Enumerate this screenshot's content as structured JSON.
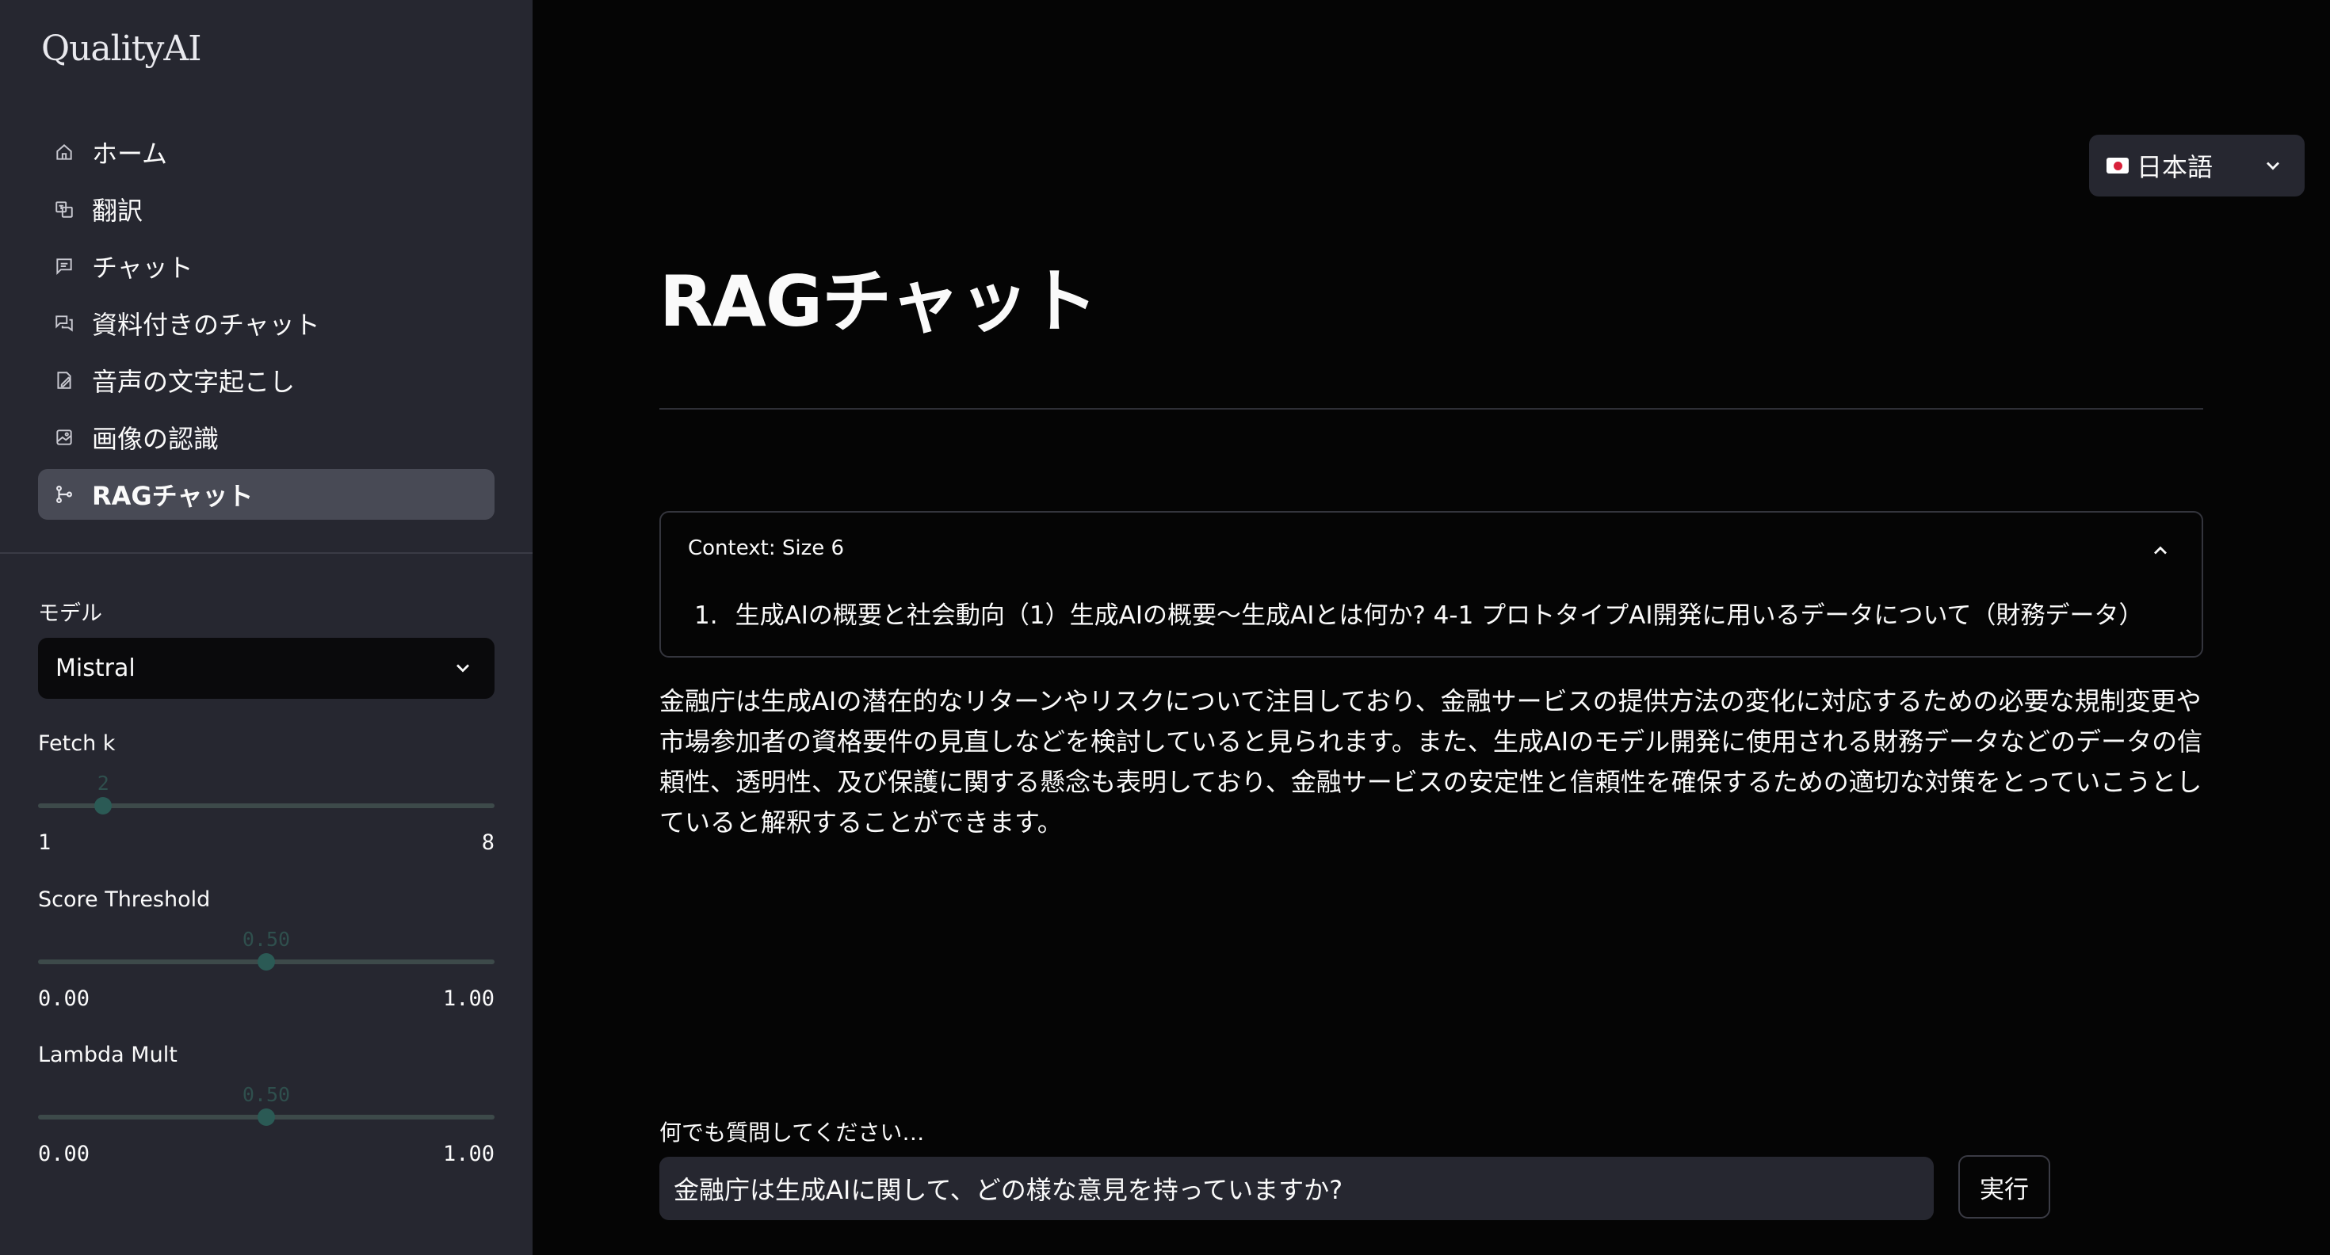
{
  "sidebar": {
    "logo": "QualityAI",
    "nav": [
      {
        "label": "ホーム",
        "icon": "home-icon"
      },
      {
        "label": "翻訳",
        "icon": "translate-icon"
      },
      {
        "label": "チャット",
        "icon": "chat-icon"
      },
      {
        "label": "資料付きのチャット",
        "icon": "chat-with-docs-icon"
      },
      {
        "label": "音声の文字起こし",
        "icon": "transcription-icon"
      },
      {
        "label": "画像の認識",
        "icon": "image-recognition-icon"
      },
      {
        "label": "RAGチャット",
        "icon": "rag-chat-icon",
        "active": true
      }
    ],
    "model": {
      "label": "モデル",
      "value": "Mistral"
    },
    "fetch_k": {
      "label": "Fetch k",
      "value": "2",
      "min": "1",
      "max": "8",
      "fraction": 0.1429
    },
    "score_threshold": {
      "label": "Score Threshold",
      "value": "0.50",
      "min": "0.00",
      "max": "1.00",
      "fraction": 0.5
    },
    "lambda_mult": {
      "label": "Lambda Mult",
      "value": "0.50",
      "min": "0.00",
      "max": "1.00",
      "fraction": 0.5
    }
  },
  "language": {
    "label": "日本語",
    "icon": "japan-flag-icon"
  },
  "main": {
    "title": "RAGチャット",
    "context": {
      "header": "Context: Size 6",
      "items": [
        {
          "num": "1.",
          "text": "生成AIの概要と社会動向（1）生成AIの概要～生成AIとは何か?  4-1 プロトタイプAI開発に用いるデータについて（財務データ）"
        }
      ]
    },
    "answer": "金融庁は生成AIの潜在的なリターンやリスクについて注目しており、金融サービスの提供方法の変化に対応するための必要な規制変更や市場参加者の資格要件の見直しなどを検討していると見られます。また、生成AIのモデル開発に使用される財務データなどのデータの信頼性、透明性、及び保護に関する懸念も表明しており、金融サービスの安定性と信頼性を確保するための適切な対策をとっていこうとしていると解釈することができます。",
    "question_label": "何でも質問してください…",
    "question_value": "金融庁は生成AIに関して、どの様な意見を持っていますか?",
    "run_label": "実行"
  },
  "colors": {
    "sidebar_bg": "#262730",
    "main_bg": "#050505",
    "active_item_bg": "#484a55",
    "slider_thumb": "#2b5a55"
  }
}
